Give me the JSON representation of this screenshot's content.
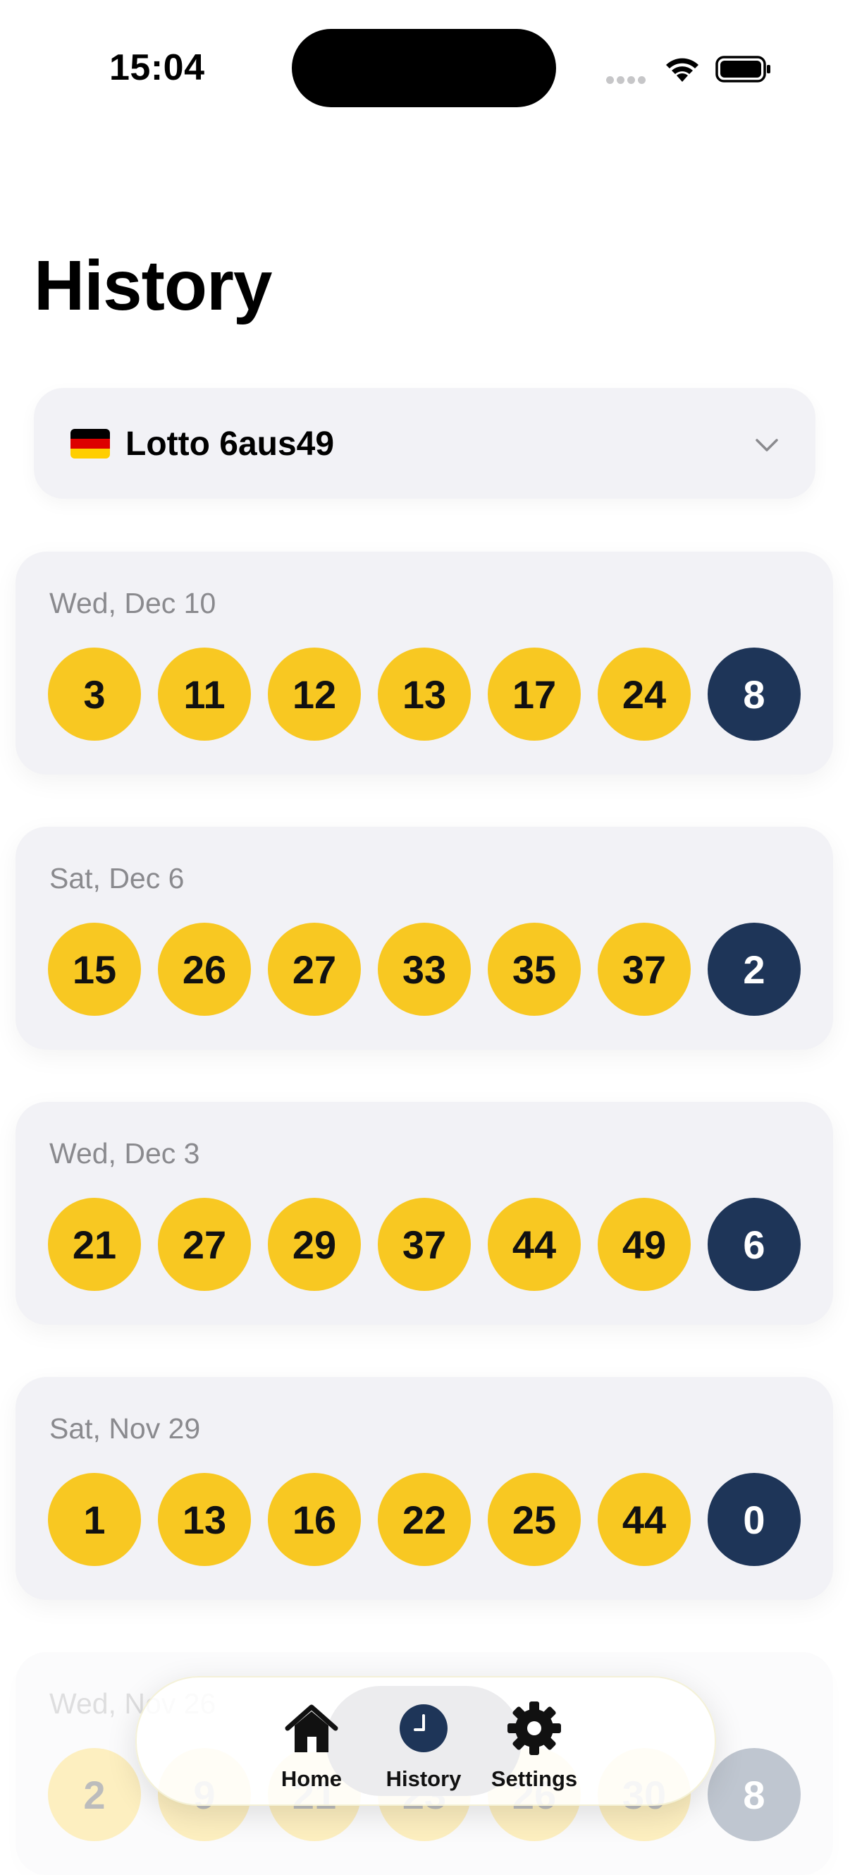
{
  "status_bar": {
    "time": "15:04"
  },
  "page": {
    "title": "History"
  },
  "game_selector": {
    "label": "Lotto 6aus49",
    "flag_icon": "germany-flag-icon",
    "chevron_icon": "chevron-down-icon",
    "flag_colors": [
      "#000000",
      "#dd0000",
      "#ffce00"
    ]
  },
  "colors": {
    "main_ball": "#f8c822",
    "bonus_ball": "#1e3558",
    "card_bg": "#f2f2f6",
    "date_text": "#8a8a8e"
  },
  "draws": [
    {
      "date": "Wed, Dec 10",
      "numbers": [
        "3",
        "11",
        "12",
        "13",
        "17",
        "24"
      ],
      "bonus": "8"
    },
    {
      "date": "Sat, Dec 6",
      "numbers": [
        "15",
        "26",
        "27",
        "33",
        "35",
        "37"
      ],
      "bonus": "2"
    },
    {
      "date": "Wed, Dec 3",
      "numbers": [
        "21",
        "27",
        "29",
        "37",
        "44",
        "49"
      ],
      "bonus": "6"
    },
    {
      "date": "Sat, Nov 29",
      "numbers": [
        "1",
        "13",
        "16",
        "22",
        "25",
        "44"
      ],
      "bonus": "0"
    },
    {
      "date": "Wed, Nov 26",
      "numbers": [
        "2",
        "9",
        "21",
        "23",
        "26",
        "30"
      ],
      "bonus": "8"
    }
  ],
  "tab_bar": {
    "tabs": [
      {
        "label": "Home",
        "icon": "house-icon",
        "active": false
      },
      {
        "label": "History",
        "icon": "clock-icon",
        "active": true
      },
      {
        "label": "Settings",
        "icon": "gear-icon",
        "active": false
      }
    ]
  }
}
